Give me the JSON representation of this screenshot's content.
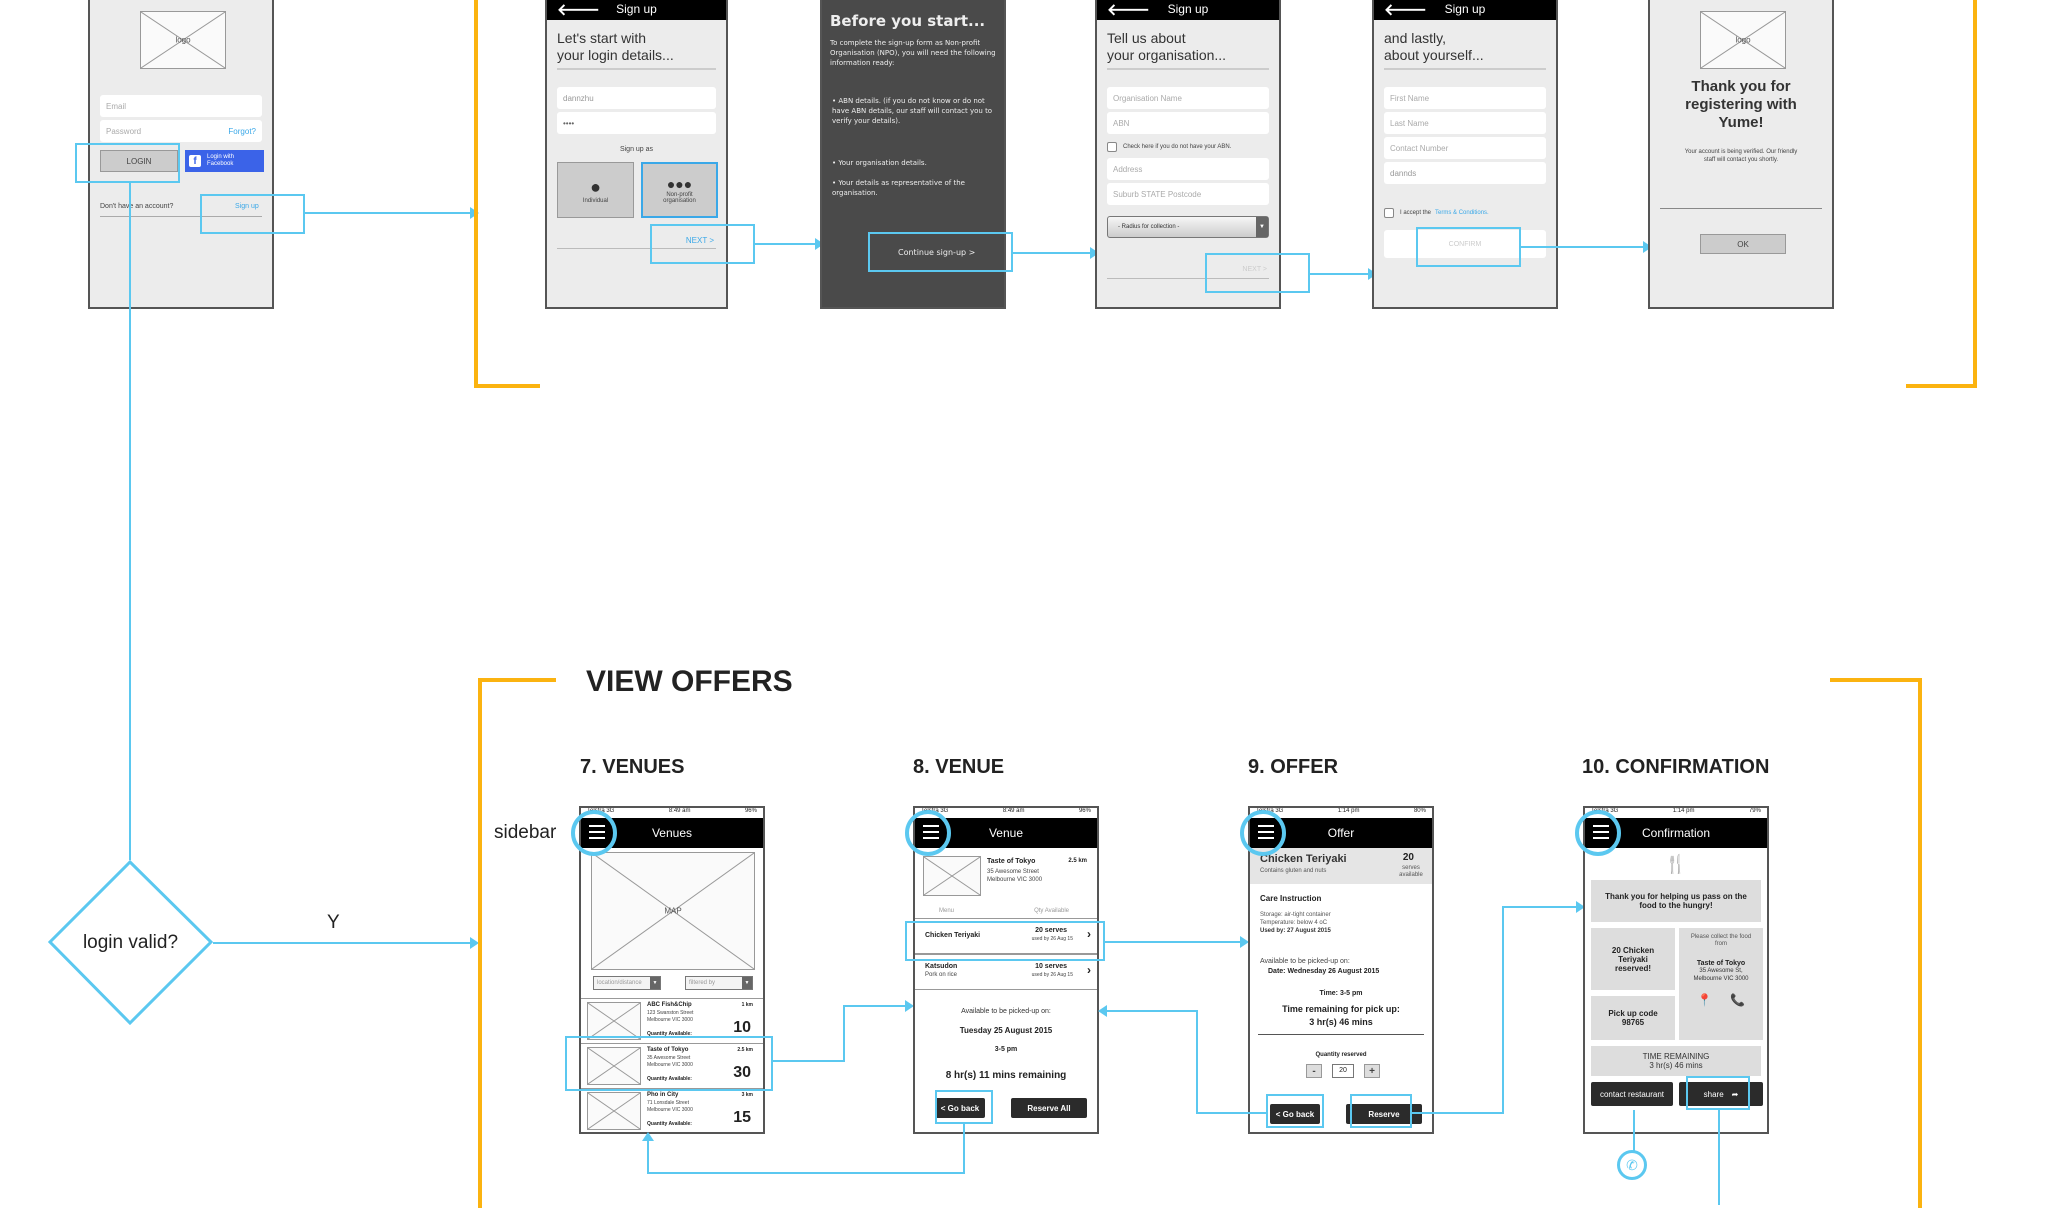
{
  "login": {
    "logo_label": "logo",
    "email_placeholder": "Email",
    "password_placeholder": "Password",
    "forgot_link": "Forgot?",
    "login_button": "LOGIN",
    "facebook_button": "Login with Facebook",
    "no_account_text": "Don't have an account?",
    "signup_link": "Sign up"
  },
  "decision": {
    "label": "login valid?",
    "yes_label": "Y"
  },
  "signup1": {
    "title": "Sign up",
    "heading_line1": "Let's start with",
    "heading_line2": "your login details...",
    "username_value": "dannzhu",
    "password_value": "••••",
    "signup_as": "Sign up as",
    "individual": "Individual",
    "nonprofit": "Non-profit organisation",
    "next": "NEXT >"
  },
  "before_start": {
    "title": "Before you start...",
    "intro": "To complete the sign-up form as Non-profit Organisation (NPO), you will need the following information ready:",
    "bullet1": "• ABN details. (if you do not know or do not have ABN details, our staff will contact you to verify your details).",
    "bullet2": "• Your organisation details.",
    "bullet3": "• Your details as representative of the organisation.",
    "continue": "Continue sign-up >"
  },
  "signup2": {
    "title": "Sign up",
    "heading_line1": "Tell us about",
    "heading_line2": "your organisation...",
    "org_name": "Organisation Name",
    "abn": "ABN",
    "abn_check": "Check here if you do not have your ABN.",
    "address": "Address",
    "suburb": "Suburb STATE Postcode",
    "radius": "- Radius for collection -",
    "next": "NEXT >"
  },
  "signup3": {
    "title": "Sign up",
    "heading_line1": "and lastly,",
    "heading_line2": "about yourself...",
    "first_name": "First Name",
    "last_name": "Last Name",
    "contact": "Contact Number",
    "field4_value": "dannds",
    "accept_text": "I accept the",
    "terms_link": "Terms & Conditions.",
    "confirm": "CONFIRM"
  },
  "thanks": {
    "logo_label": "logo",
    "heading": "Thank you for registering with Yume!",
    "body": "Your account is being verified. Our friendly staff will contact you shortly.",
    "ok": "OK"
  },
  "view_offers": {
    "section_title": "VIEW OFFERS",
    "sidebar_label": "sidebar"
  },
  "venues": {
    "screen_title": "7. VENUES",
    "status_carrier": "Telstra  3G",
    "status_time": "8:49 am",
    "status_battery": "96%",
    "nav_title": "Venues",
    "map_label": "MAP",
    "filter1": "location/distance",
    "filter2": "filtered by",
    "items": [
      {
        "name": "ABC Fish&Chip",
        "addr1": "123 Swanston Street",
        "addr2": "Melbourne VIC 3000",
        "dist": "1 km",
        "qty_label": "Quantity Available:",
        "qty": "10"
      },
      {
        "name": "Taste of Tokyo",
        "addr1": "35 Awesome Street",
        "addr2": "Melbourne VIC 3000",
        "dist": "2.5 km",
        "qty_label": "Quantity Available:",
        "qty": "30"
      },
      {
        "name": "Pho in City",
        "addr1": "71 Lonsdale Street",
        "addr2": "Melbourne VIC 3000",
        "dist": "3 km",
        "qty_label": "Quantity Available:",
        "qty": "15"
      }
    ]
  },
  "venue": {
    "screen_title": "8. VENUE",
    "status_carrier": "Telstra  3G",
    "status_time": "8:49 am",
    "status_battery": "96%",
    "nav_title": "Venue",
    "venue_name": "Taste of Tokyo",
    "venue_addr1": "35 Awesome Street",
    "venue_addr2": "Melbourne VIC 3000",
    "venue_dist": "2.5 km",
    "col_menu": "Menu",
    "col_qty": "Qty Available",
    "menu": [
      {
        "name": "Chicken Teriyaki",
        "sub": "",
        "serves": "20 serves",
        "used_by": "used by 26 Aug 15"
      },
      {
        "name": "Katsudon",
        "sub": "Pork on rice",
        "serves": "10 serves",
        "used_by": "used by 26 Aug 15"
      }
    ],
    "pickup_label": "Available to be picked-up on:",
    "pickup_date": "Tuesday 25 August 2015",
    "pickup_time": "3-5 pm",
    "remaining": "8 hr(s) 11 mins remaining",
    "go_back": "< Go back",
    "reserve_all": "Reserve All"
  },
  "offer": {
    "screen_title": "9. OFFER",
    "status_carrier": "Telstra  3G",
    "status_time": "1:14 pm",
    "status_battery": "80%",
    "nav_title": "Offer",
    "dish": "Chicken Teriyaki",
    "dish_note": "Contains gluten and nuts",
    "serves_num": "20",
    "serves_label": "serves available",
    "care_title": "Care Instruction",
    "storage": "Storage: air-tight container",
    "temperature": "Temperature: below 4  oC",
    "used_by": "Used by: 27 August 2015",
    "pickup_label": "Available to be picked-up on:",
    "pickup_date": "Date: Wednesday 26 August 2015",
    "pickup_time": "Time: 3-5 pm",
    "remaining_label": "Time remaining for pick up:",
    "remaining": "3 hr(s) 46 mins",
    "qty_label": "Quantity reserved",
    "minus": "-",
    "qty_value": "20",
    "plus": "+",
    "go_back": "< Go back",
    "reserve": "Reserve"
  },
  "confirmation": {
    "screen_title": "10. CONFIRMATION",
    "status_carrier": "Telstra  3G",
    "status_time": "1:14 pm",
    "status_battery": "79%",
    "nav_title": "Confirmation",
    "thanks": "Thank you for helping us pass on the food to the hungry!",
    "reserved": "20 Chicken Teriyaki reserved!",
    "collect_label": "Please collect the food from",
    "collect_name": "Taste of Tokyo",
    "collect_addr": "35 Awesome St, Melbourne VIC 3000",
    "pickup_code_label": "Pick up code",
    "pickup_code": "98765",
    "time_remaining_label": "TIME REMAINING",
    "time_remaining": "3 hr(s) 46 mins",
    "contact": "contact restaurant",
    "share": "share"
  },
  "colors": {
    "flow_line": "#5bc8f0",
    "section_bracket": "#fbb310",
    "nav_bar": "#000000",
    "facebook": "#3b5998",
    "link": "#3aa8e8"
  }
}
